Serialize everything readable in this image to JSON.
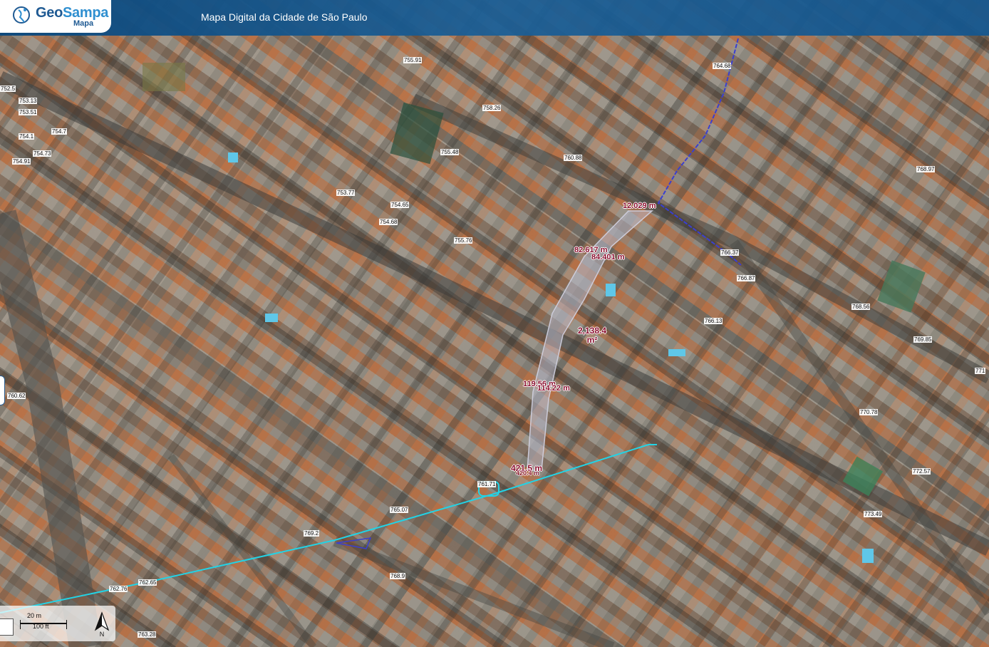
{
  "header": {
    "logo_name_part1": "Geo",
    "logo_name_part2": "Sampa",
    "logo_sub": "Mapa",
    "title": "Mapa Digital da Cidade de São Paulo"
  },
  "elevation_points": [
    {
      "label": "755.91"
    },
    {
      "label": "764.68"
    },
    {
      "label": "752.5"
    },
    {
      "label": "753.13"
    },
    {
      "label": "753.51"
    },
    {
      "label": "754.7"
    },
    {
      "label": "754.1"
    },
    {
      "label": "754.73"
    },
    {
      "label": "754.91"
    },
    {
      "label": "758.26"
    },
    {
      "label": "755.48"
    },
    {
      "label": "760.88"
    },
    {
      "label": "768.97"
    },
    {
      "label": "753.77"
    },
    {
      "label": "754.65"
    },
    {
      "label": "754.68"
    },
    {
      "label": "755.76"
    },
    {
      "label": "766.37"
    },
    {
      "label": "766.87"
    },
    {
      "label": "768.56"
    },
    {
      "label": "766.13"
    },
    {
      "label": "769.85"
    },
    {
      "label": "771"
    },
    {
      "label": "760.62"
    },
    {
      "label": "770.78"
    },
    {
      "label": "772.57"
    },
    {
      "label": "761.71"
    },
    {
      "label": "765.07"
    },
    {
      "label": "773.49"
    },
    {
      "label": "769.2"
    },
    {
      "label": "768.9"
    },
    {
      "label": "762.76"
    },
    {
      "label": "762.65"
    },
    {
      "label": "763.28"
    }
  ],
  "measurements": {
    "distance_1": "12.029 m",
    "distance_2": "82.617 m",
    "distance_3": "84.401 m",
    "area_value": "2,138.4",
    "area_unit": "m²",
    "distance_4": "119.56 m",
    "distance_5": "114.22 m",
    "distance_6": "421.5 m",
    "distance_7": "420.4 m"
  },
  "scale": {
    "metric": "20 m",
    "imperial": "100 ft"
  },
  "north_label": "N",
  "icons": {
    "logo": "geosampa-logo-icon",
    "north": "north-arrow-icon"
  },
  "colors": {
    "header": "#14568e",
    "measure_line": "#22d3e6",
    "boundary_line": "#3a3fd0",
    "measure_text": "#8b1030",
    "area_fill": "#b8b8c8"
  }
}
